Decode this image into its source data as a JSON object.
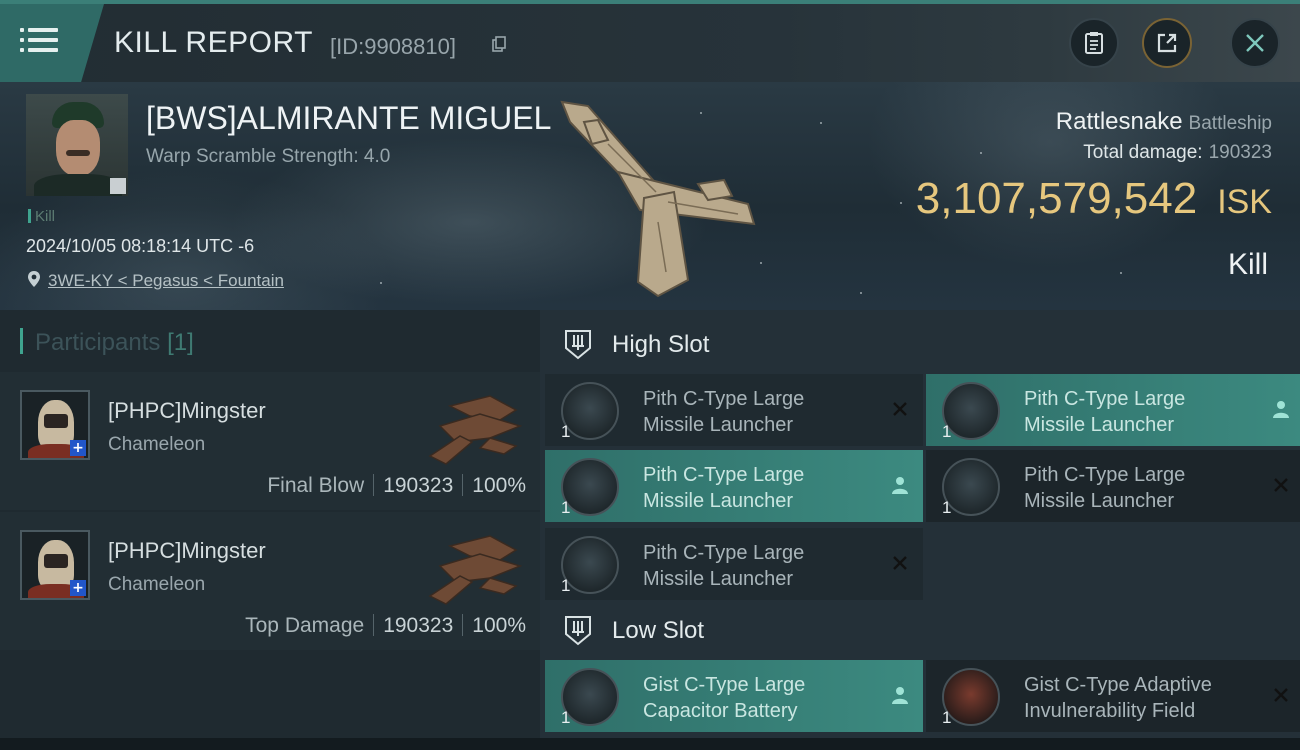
{
  "header": {
    "title": "KILL REPORT",
    "report_id": "[ID:9908810]"
  },
  "victim": {
    "name": "[BWS]ALMIRANTE MIGUEL",
    "warp_scramble": "Warp Scramble Strength: 4.0",
    "kill_tag": "Kill",
    "datetime": "2024/10/05 08:18:14 UTC -6",
    "location": "3WE-KY < Pegasus < Fountain"
  },
  "ship": {
    "name": "Rattlesnake",
    "class": "Battleship",
    "total_damage_label": "Total damage:",
    "total_damage": "190323",
    "isk_value": "3,107,579,542",
    "isk_unit": "ISK",
    "result": "Kill"
  },
  "participants": {
    "label": "Participants",
    "count": "[1]",
    "rows": [
      {
        "name": "[PHPC]Mingster",
        "ship": "Chameleon",
        "role": "Final Blow",
        "damage": "190323",
        "percent": "100%"
      },
      {
        "name": "[PHPC]Mingster",
        "ship": "Chameleon",
        "role": "Top Damage",
        "damage": "190323",
        "percent": "100%"
      }
    ]
  },
  "fitting": {
    "high_slot": {
      "label": "High Slot",
      "modules": [
        {
          "line1": "Pith C-Type Large",
          "line2": "Missile Launcher",
          "qty": "1",
          "status": "destroyed"
        },
        {
          "line1": "Pith C-Type Large",
          "line2": "Missile Launcher",
          "qty": "1",
          "status": "dropped"
        },
        {
          "line1": "Pith C-Type Large",
          "line2": "Missile Launcher",
          "qty": "1",
          "status": "dropped"
        },
        {
          "line1": "Pith C-Type Large",
          "line2": "Missile Launcher",
          "qty": "1",
          "status": "destroyed"
        },
        {
          "line1": "Pith C-Type Large",
          "line2": "Missile Launcher",
          "qty": "1",
          "status": "destroyed"
        }
      ]
    },
    "low_slot": {
      "label": "Low Slot",
      "modules": [
        {
          "line1": "Gist C-Type Large",
          "line2": "Capacitor Battery",
          "qty": "1",
          "status": "dropped"
        },
        {
          "line1": "Gist C-Type Adaptive",
          "line2": "Invulnerability Field",
          "qty": "1",
          "status": "destroyed"
        }
      ]
    }
  },
  "colors": {
    "accent": "#3fa48f",
    "isk": "#e6c77e",
    "dropped_row": "#3c8a80"
  },
  "icons": [
    "menu-icon",
    "copy-icon",
    "clipboard-icon",
    "share-icon",
    "close-icon",
    "location-pin-icon",
    "slot-icon",
    "destroyed-x-icon",
    "dropped-person-icon"
  ]
}
